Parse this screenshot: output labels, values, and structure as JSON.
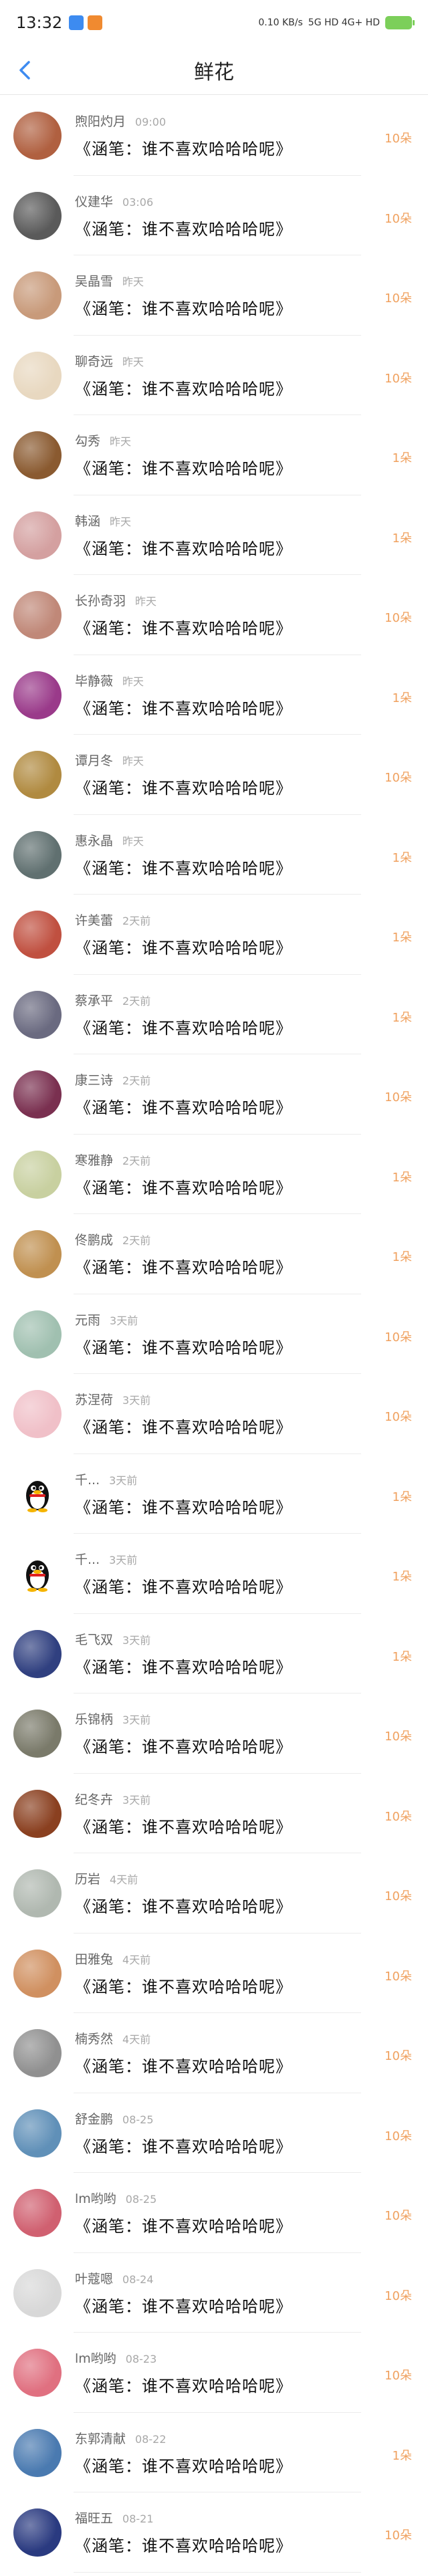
{
  "status_bar": {
    "time": "13:32",
    "signal_text": "0.10 KB/s",
    "network_text": "5G HD 4G+ HD"
  },
  "header": {
    "title": "鲜花"
  },
  "rows": [
    {
      "name": "煦阳灼月",
      "time": "09:00",
      "message": "《涵笔：谁不喜欢哈哈哈呢》",
      "count": "10朵",
      "avatar_color": "#b06040"
    },
    {
      "name": "仪建华",
      "time": "03:06",
      "message": "《涵笔：谁不喜欢哈哈哈呢》",
      "count": "10朵",
      "avatar_color": "#5a5a5a"
    },
    {
      "name": "吴晶雪",
      "time": "昨天",
      "message": "《涵笔：谁不喜欢哈哈哈呢》",
      "count": "10朵",
      "avatar_color": "#c89a7a"
    },
    {
      "name": "聊奇远",
      "time": "昨天",
      "message": "《涵笔：谁不喜欢哈哈哈呢》",
      "count": "10朵",
      "avatar_color": "#e8d8c0"
    },
    {
      "name": "勾秀",
      "time": "昨天",
      "message": "《涵笔：谁不喜欢哈哈哈呢》",
      "count": "1朵",
      "avatar_color": "#8a5a30"
    },
    {
      "name": "韩涵",
      "time": "昨天",
      "message": "《涵笔：谁不喜欢哈哈哈呢》",
      "count": "1朵",
      "avatar_color": "#d4a0a0"
    },
    {
      "name": "长孙奇羽",
      "time": "昨天",
      "message": "《涵笔：谁不喜欢哈哈哈呢》",
      "count": "10朵",
      "avatar_color": "#c08878"
    },
    {
      "name": "毕静薇",
      "time": "昨天",
      "message": "《涵笔：谁不喜欢哈哈哈呢》",
      "count": "1朵",
      "avatar_color": "#9a3a8a"
    },
    {
      "name": "谭月冬",
      "time": "昨天",
      "message": "《涵笔：谁不喜欢哈哈哈呢》",
      "count": "10朵",
      "avatar_color": "#b08a40"
    },
    {
      "name": "惠永晶",
      "time": "昨天",
      "message": "《涵笔：谁不喜欢哈哈哈呢》",
      "count": "1朵",
      "avatar_color": "#607070"
    },
    {
      "name": "许美蕾",
      "time": "2天前",
      "message": "《涵笔：谁不喜欢哈哈哈呢》",
      "count": "1朵",
      "avatar_color": "#c05040"
    },
    {
      "name": "蔡承平",
      "time": "2天前",
      "message": "《涵笔：谁不喜欢哈哈哈呢》",
      "count": "1朵",
      "avatar_color": "#6a6a80"
    },
    {
      "name": "康三诗",
      "time": "2天前",
      "message": "《涵笔：谁不喜欢哈哈哈呢》",
      "count": "10朵",
      "avatar_color": "#7a3050"
    },
    {
      "name": "寒雅静",
      "time": "2天前",
      "message": "《涵笔：谁不喜欢哈哈哈呢》",
      "count": "1朵",
      "avatar_color": "#c8d0a0"
    },
    {
      "name": "佟鹏成",
      "time": "2天前",
      "message": "《涵笔：谁不喜欢哈哈哈呢》",
      "count": "1朵",
      "avatar_color": "#c09050"
    },
    {
      "name": "元雨",
      "time": "3天前",
      "message": "《涵笔：谁不喜欢哈哈哈呢》",
      "count": "10朵",
      "avatar_color": "#a0c0b0"
    },
    {
      "name": "苏涅荷",
      "time": "3天前",
      "message": "《涵笔：谁不喜欢哈哈哈呢》",
      "count": "10朵",
      "avatar_color": "#f0c0c8"
    },
    {
      "name": "千...",
      "time": "3天前",
      "message": "《涵笔：谁不喜欢哈哈哈呢》",
      "count": "1朵",
      "avatar_color": "qq"
    },
    {
      "name": "千...",
      "time": "3天前",
      "message": "《涵笔：谁不喜欢哈哈哈呢》",
      "count": "1朵",
      "avatar_color": "qq"
    },
    {
      "name": "毛飞双",
      "time": "3天前",
      "message": "《涵笔：谁不喜欢哈哈哈呢》",
      "count": "1朵",
      "avatar_color": "#304080"
    },
    {
      "name": "乐锦柄",
      "time": "3天前",
      "message": "《涵笔：谁不喜欢哈哈哈呢》",
      "count": "10朵",
      "avatar_color": "#7a7a6a"
    },
    {
      "name": "纪冬卉",
      "time": "3天前",
      "message": "《涵笔：谁不喜欢哈哈哈呢》",
      "count": "10朵",
      "avatar_color": "#8a4020"
    },
    {
      "name": "历岩",
      "time": "4天前",
      "message": "《涵笔：谁不喜欢哈哈哈呢》",
      "count": "10朵",
      "avatar_color": "#b0b8b0"
    },
    {
      "name": "田雅兔",
      "time": "4天前",
      "message": "《涵笔：谁不喜欢哈哈哈呢》",
      "count": "10朵",
      "avatar_color": "#d09060"
    },
    {
      "name": "楠秀然",
      "time": "4天前",
      "message": "《涵笔：谁不喜欢哈哈哈呢》",
      "count": "10朵",
      "avatar_color": "#909090"
    },
    {
      "name": "舒金鹏",
      "time": "08-25",
      "message": "《涵笔：谁不喜欢哈哈哈呢》",
      "count": "10朵",
      "avatar_color": "#6090b8"
    },
    {
      "name": "lm哟哟",
      "time": "08-25",
      "message": "《涵笔：谁不喜欢哈哈哈呢》",
      "count": "10朵",
      "avatar_color": "#d06070"
    },
    {
      "name": "叶蔻嗯",
      "time": "08-24",
      "message": "《涵笔：谁不喜欢哈哈哈呢》",
      "count": "10朵",
      "avatar_color": "#d8d8d8"
    },
    {
      "name": "lm哟哟",
      "time": "08-23",
      "message": "《涵笔：谁不喜欢哈哈哈呢》",
      "count": "10朵",
      "avatar_color": "#e07080"
    },
    {
      "name": "东郭清献",
      "time": "08-22",
      "message": "《涵笔：谁不喜欢哈哈哈呢》",
      "count": "1朵",
      "avatar_color": "#4a7ab0"
    },
    {
      "name": "福旺五",
      "time": "08-21",
      "message": "《涵笔：谁不喜欢哈哈哈呢》",
      "count": "10朵",
      "avatar_color": "#2a3a80"
    }
  ]
}
